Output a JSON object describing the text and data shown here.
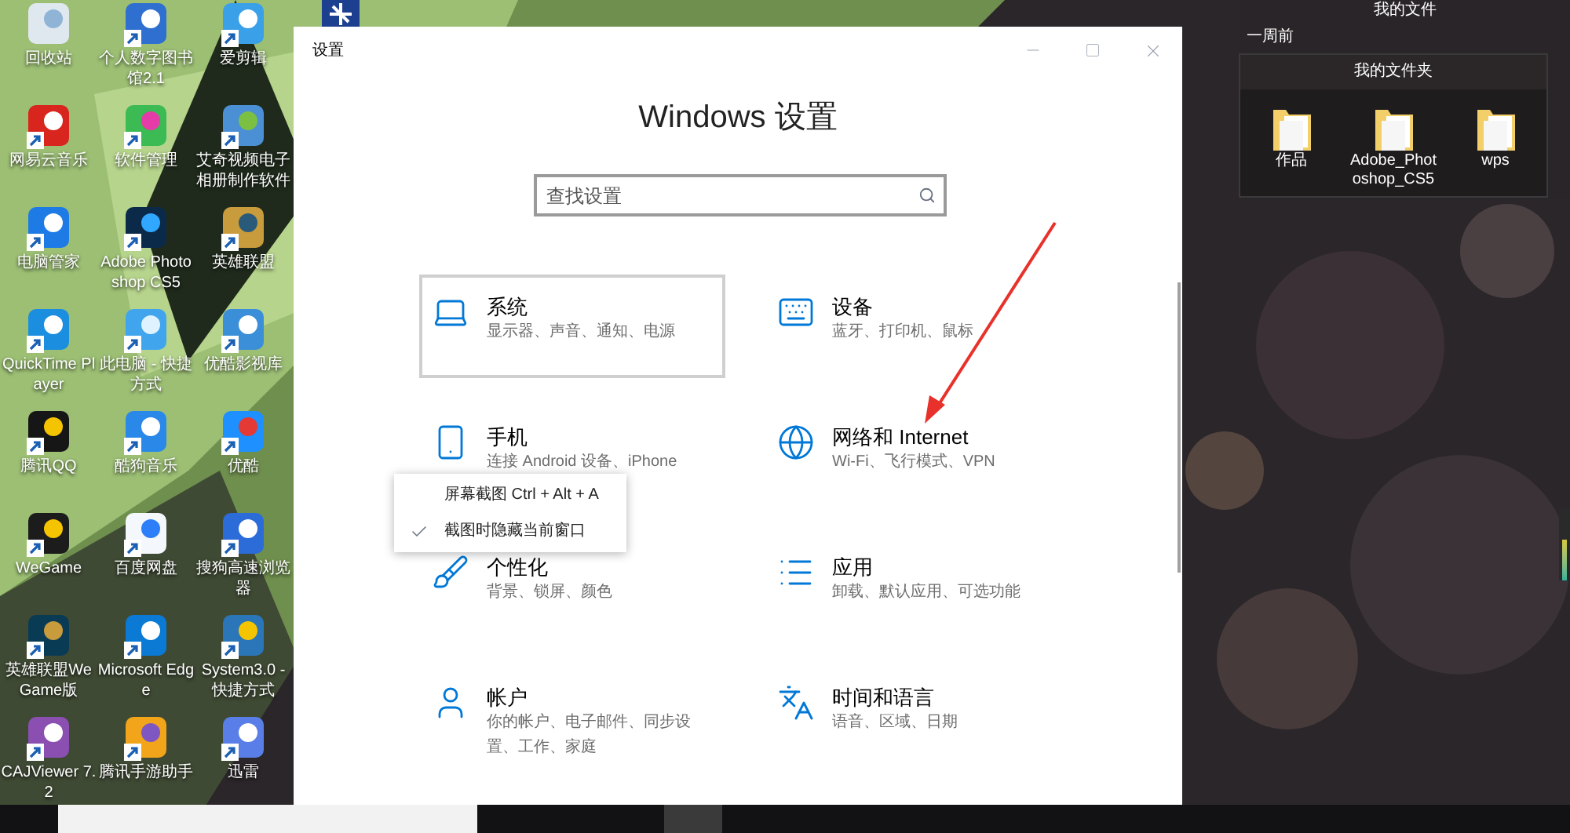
{
  "desktop_icons": [
    {
      "label": "回收站",
      "shortcut": false
    },
    {
      "label": "个人数字图书馆2.1",
      "shortcut": true
    },
    {
      "label": "爱剪辑",
      "shortcut": true
    },
    {
      "label": "网易云音乐",
      "shortcut": true
    },
    {
      "label": "软件管理",
      "shortcut": true
    },
    {
      "label": "艾奇视频电子相册制作软件",
      "shortcut": true
    },
    {
      "label": "电脑管家",
      "shortcut": true
    },
    {
      "label": "Adobe Photoshop CS5",
      "shortcut": true
    },
    {
      "label": "英雄联盟",
      "shortcut": true
    },
    {
      "label": "QuickTime Player",
      "shortcut": true
    },
    {
      "label": "此电脑 - 快捷方式",
      "shortcut": true
    },
    {
      "label": "优酷影视库",
      "shortcut": true
    },
    {
      "label": "腾讯QQ",
      "shortcut": true
    },
    {
      "label": "酷狗音乐",
      "shortcut": true
    },
    {
      "label": "优酷",
      "shortcut": true
    },
    {
      "label": "WeGame",
      "shortcut": true
    },
    {
      "label": "百度网盘",
      "shortcut": true
    },
    {
      "label": "搜狗高速浏览器",
      "shortcut": true
    },
    {
      "label": "英雄联盟WeGame版",
      "shortcut": true
    },
    {
      "label": "Microsoft Edge",
      "shortcut": true
    },
    {
      "label": "System3.0 - 快捷方式",
      "shortcut": true
    },
    {
      "label": "CAJViewer 7.2",
      "shortcut": true
    },
    {
      "label": "腾讯手游助手",
      "shortcut": true
    },
    {
      "label": "迅雷",
      "shortcut": true
    }
  ],
  "window": {
    "title": "设置",
    "heading": "Windows 设置"
  },
  "search": {
    "placeholder": "查找设置"
  },
  "settings_items": [
    {
      "title": "系统",
      "description": "显示器、声音、通知、电源",
      "selected": true
    },
    {
      "title": "设备",
      "description": "蓝牙、打印机、鼠标",
      "selected": false
    },
    {
      "title": "手机",
      "description": "连接 Android 设备、iPhone",
      "selected": false
    },
    {
      "title": "网络和 Internet",
      "description": "Wi-Fi、飞行模式、VPN",
      "selected": false
    },
    {
      "title": "个性化",
      "description": "背景、锁屏、颜色",
      "selected": false
    },
    {
      "title": "应用",
      "description": "卸载、默认应用、可选功能",
      "selected": false
    },
    {
      "title": "帐户",
      "description": "你的帐户、电子邮件、同步设置、工作、家庭",
      "selected": false
    },
    {
      "title": "时间和语言",
      "description": "语音、区域、日期",
      "selected": false
    }
  ],
  "context_menu": [
    {
      "label": "屏幕截图 Ctrl + Alt + A",
      "checked": false
    },
    {
      "label": "截图时隐藏当前窗口",
      "checked": true
    }
  ],
  "file_widget": {
    "title": "我的文件",
    "recent_label": "一周前",
    "folders_title": "我的文件夹",
    "folders": [
      "作品",
      "Adobe_Photoshop_CS5",
      "wps"
    ]
  }
}
